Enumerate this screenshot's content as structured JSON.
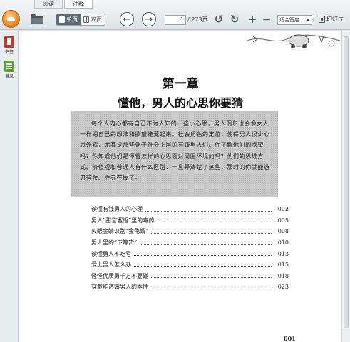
{
  "tabs": [
    {
      "label": "阅读",
      "active": false
    },
    {
      "label": "注释",
      "active": true
    }
  ],
  "toolbar": {
    "single_page_label": "单页",
    "double_page_label": "双页",
    "prev_icon": "arrow-left-icon",
    "next_icon": "arrow-right-icon",
    "current_page": "1",
    "total_pages": "/ 273页",
    "zoom_value": "适合宽度",
    "slideshow_label": "幻灯片"
  },
  "sidebar": {
    "items": [
      {
        "label": "书签",
        "icon": "bookmark-icon"
      },
      {
        "label": "目录",
        "icon": "toc-icon"
      }
    ]
  },
  "document": {
    "chapter_number": "第一章",
    "chapter_title": "懂他，男人的心思你要猜",
    "intro": "每个人内心都有自己不为人知的一些小心思，男人偶尔也会像女人一样把自己的想法和欲望掩藏起来。社会角色的定位，使得男人很少心思外露，尤其是那些处于社会上层的有钱男人们。你了解他们的欲望吗？你知道他们是怀着怎样的心思面对周围环境的吗？他们的思维方式、价值观和普通人有什么区别？一旦弄清楚了这些，那时的你就能游刃有余、胜券在握了。",
    "toc": [
      {
        "title": "读懂有钱男人的心理",
        "page": "002"
      },
      {
        "title": "男人“甜言蜜语”里的毒药",
        "page": "005"
      },
      {
        "title": "火眼金睛识别“金龟婿”",
        "page": "008"
      },
      {
        "title": "男人里的“下等货”",
        "page": "010"
      },
      {
        "title": "读懂男人不吃亏",
        "page": "013"
      },
      {
        "title": "爱上男人怎么办",
        "page": "015"
      },
      {
        "title": "怪怪优质男千万不要碰",
        "page": "018"
      },
      {
        "title": "穿戴能透露男人的本性",
        "page": "023"
      }
    ],
    "page_number": "001"
  }
}
